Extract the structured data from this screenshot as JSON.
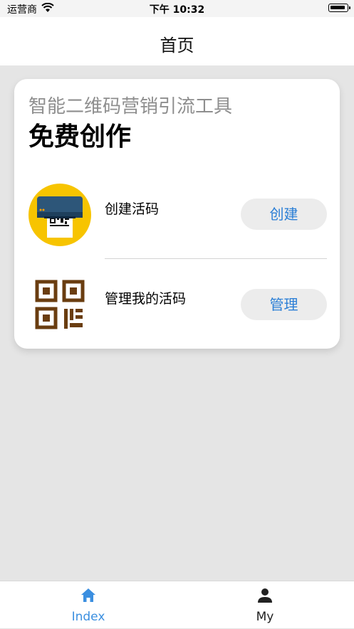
{
  "status_bar": {
    "carrier": "运营商",
    "time": "下午 10:32"
  },
  "nav": {
    "title": "首页"
  },
  "card": {
    "subtitle": "智能二维码营销引流工具",
    "headline": "免费创作",
    "rows": [
      {
        "label": "创建活码",
        "button": "创建",
        "icon": "printer-qr-icon"
      },
      {
        "label": "管理我的活码",
        "button": "管理",
        "icon": "qr-code-icon"
      }
    ]
  },
  "tabs": [
    {
      "label": "Index",
      "icon": "home-icon",
      "active": true
    },
    {
      "label": "My",
      "icon": "person-icon",
      "active": false
    }
  ],
  "colors": {
    "accent": "#2b7fd6",
    "tab_active": "#3b8fe0",
    "background": "#e5e5e5"
  }
}
